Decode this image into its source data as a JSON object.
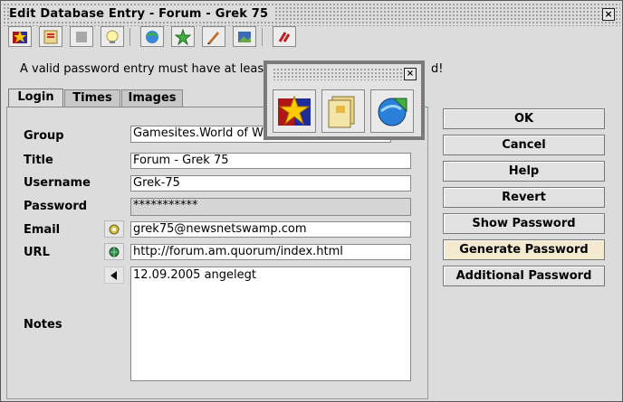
{
  "window": {
    "title": "Edit Database Entry - Forum - Grek 75"
  },
  "toolbar": {
    "icons": [
      "star-folder-icon",
      "map-book-icon",
      "disabled-icon",
      "lightbulb-icon",
      "globe-refresh-icon",
      "star-new-icon",
      "pen-icon",
      "image-icon",
      "exit-icon"
    ]
  },
  "info": {
    "text_left": "A valid password entry must have at least '",
    "text_right": "d!"
  },
  "tabs": [
    {
      "label": "Login"
    },
    {
      "label": "Times"
    },
    {
      "label": "Images"
    }
  ],
  "form": {
    "group": {
      "label": "Group",
      "value": "Gamesites.World of Wo"
    },
    "title": {
      "label": "Title",
      "value": "Forum - Grek 75"
    },
    "username": {
      "label": "Username",
      "value": "Grek-75"
    },
    "password": {
      "label": "Password",
      "value": "***********"
    },
    "email": {
      "label": "Email",
      "value": "grek75@newsnetswamp.com"
    },
    "url": {
      "label": "URL",
      "value": "http://forum.am.quorum/index.html"
    },
    "notes": {
      "label": "Notes",
      "value": "12.09.2005 angelegt"
    }
  },
  "buttons": {
    "ok": "OK",
    "cancel": "Cancel",
    "help": "Help",
    "revert": "Revert",
    "show_password": "Show Password",
    "generate_password": "Generate Password",
    "additional_password": "Additional Password"
  },
  "popup": {
    "close": "×",
    "icons": [
      "star-folder-icon",
      "documents-icon",
      "globe-arrow-icon"
    ]
  },
  "colors": {
    "accent": "#f3ead0",
    "background": "#dcdcdc"
  }
}
